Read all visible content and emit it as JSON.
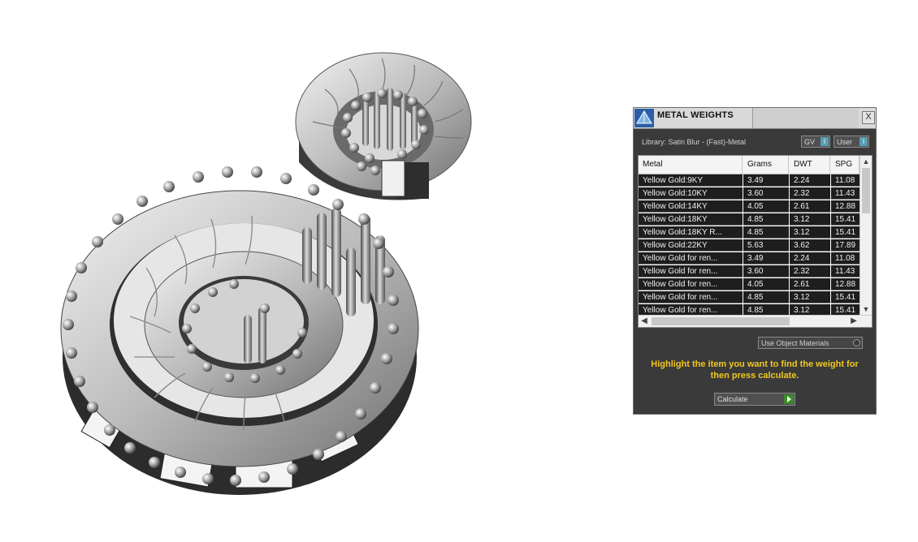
{
  "viewport": {
    "subject": "3d-jewelry-pendant-model"
  },
  "panel": {
    "title": "METAL WEIGHTS",
    "close_label": "X",
    "library_label": "Library: Satin Blur - (Fast)-Metal",
    "toggles": {
      "gv": "GV",
      "user": "User",
      "indicator": "I"
    },
    "table": {
      "columns": [
        "Metal",
        "Grams",
        "DWT",
        "SPG"
      ],
      "rows": [
        [
          "Yellow Gold:9KY",
          "3.49",
          "2.24",
          "11.08"
        ],
        [
          "Yellow Gold:10KY",
          "3.60",
          "2.32",
          "11.43"
        ],
        [
          "Yellow Gold:14KY",
          "4.05",
          "2.61",
          "12.88"
        ],
        [
          "Yellow Gold:18KY",
          "4.85",
          "3.12",
          "15.41"
        ],
        [
          "Yellow Gold:18KY R...",
          "4.85",
          "3.12",
          "15.41"
        ],
        [
          "Yellow Gold:22KY",
          "5.63",
          "3.62",
          "17.89"
        ],
        [
          "Yellow Gold for ren...",
          "3.49",
          "2.24",
          "11.08"
        ],
        [
          "Yellow Gold for ren...",
          "3.60",
          "2.32",
          "11.43"
        ],
        [
          "Yellow Gold for ren...",
          "4.05",
          "2.61",
          "12.88"
        ],
        [
          "Yellow Gold for ren...",
          "4.85",
          "3.12",
          "15.41"
        ],
        [
          "Yellow Gold for ren...",
          "4.85",
          "3.12",
          "15.41"
        ]
      ]
    },
    "use_object_materials": "Use Object Materials",
    "instructions": "Highlight the item you want to find the weight for then press calculate.",
    "calculate_label": "Calculate",
    "colors": {
      "instructions": "#f2c81e",
      "panel_bg": "#3a3a3a",
      "row_bg": "#1e1e1e",
      "toggle_indicator": "#5b9db4"
    }
  }
}
